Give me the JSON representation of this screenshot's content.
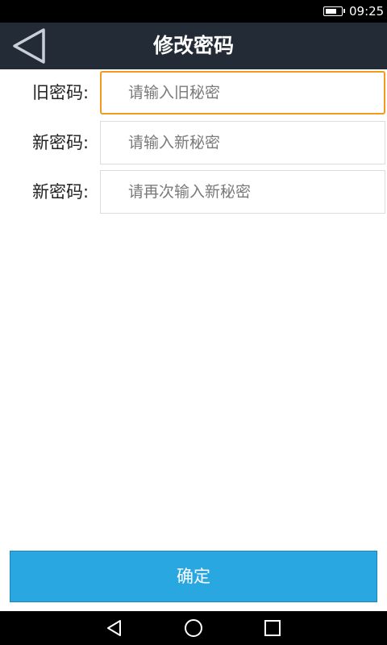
{
  "status_bar": {
    "time": "09:25",
    "battery_level": 0.75
  },
  "header": {
    "title": "修改密码",
    "back_icon": "triangle-left-icon"
  },
  "form": {
    "fields": [
      {
        "label": "旧密码:",
        "placeholder": "请输入旧秘密",
        "value": ""
      },
      {
        "label": "新密码:",
        "placeholder": "请输入新秘密",
        "value": ""
      },
      {
        "label": "新密码:",
        "placeholder": "请再次输入新秘密",
        "value": ""
      }
    ]
  },
  "confirm": {
    "label": "确定"
  },
  "colors": {
    "header_bg": "#222b36",
    "focus_border": "#f39a1f",
    "button_bg": "#29a7e1"
  }
}
